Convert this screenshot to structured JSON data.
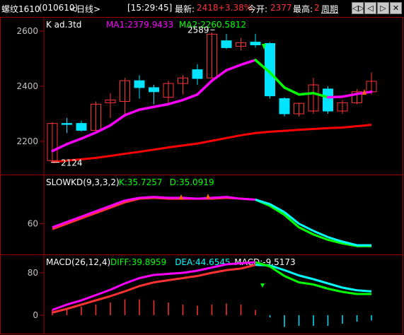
{
  "header": {
    "symbol": "螺纹1610",
    "code": "(010610)",
    "period": "<日线>",
    "time": "[15:29:45]",
    "latest_label": "最新:",
    "latest_value": "2418",
    "change_pct": "+3.38%",
    "open_label": "今开:",
    "open_value": "2377",
    "high_label": "最高:",
    "high_value": "2",
    "week_label": "周期",
    "buttons": [
      "◁▷",
      "◁",
      "▷",
      "✕"
    ]
  },
  "colors": {
    "up": "#ff3232",
    "down": "#00e4ff",
    "ma1": "#ff00ff",
    "ma2": "#ff0000",
    "grid": "#a00000",
    "axis_text": "#c0c0c0",
    "k_line": "#00ffff",
    "d_line": "#ff00ff",
    "green_seg": "#00ff00",
    "white": "#ffffff"
  },
  "chart_data": [
    {
      "type": "candlestick",
      "title": "K  ad.3td",
      "legend": [
        {
          "text": "MA1:2379.9433",
          "color": "#ff00ff"
        },
        {
          "text": "MA2:2260.5812",
          "color": "#00ff00"
        }
      ],
      "yticks": [
        "2600",
        "2400",
        "2200"
      ],
      "ylim": [
        2120,
        2640
      ],
      "annotations": {
        "high": "2589",
        "low": "2124"
      },
      "candles": [
        {
          "o": 2130,
          "h": 2270,
          "l": 2124,
          "c": 2265
        },
        {
          "o": 2265,
          "h": 2285,
          "l": 2230,
          "c": 2262
        },
        {
          "o": 2265,
          "h": 2275,
          "l": 2235,
          "c": 2240
        },
        {
          "o": 2240,
          "h": 2345,
          "l": 2238,
          "c": 2335
        },
        {
          "o": 2340,
          "h": 2375,
          "l": 2285,
          "c": 2350
        },
        {
          "o": 2345,
          "h": 2430,
          "l": 2300,
          "c": 2420
        },
        {
          "o": 2420,
          "h": 2440,
          "l": 2355,
          "c": 2395
        },
        {
          "o": 2395,
          "h": 2405,
          "l": 2335,
          "c": 2380
        },
        {
          "o": 2360,
          "h": 2420,
          "l": 2340,
          "c": 2410
        },
        {
          "o": 2410,
          "h": 2440,
          "l": 2370,
          "c": 2430
        },
        {
          "o": 2460,
          "h": 2480,
          "l": 2405,
          "c": 2428
        },
        {
          "o": 2430,
          "h": 2595,
          "l": 2430,
          "c": 2589
        },
        {
          "o": 2565,
          "h": 2590,
          "l": 2535,
          "c": 2540
        },
        {
          "o": 2545,
          "h": 2575,
          "l": 2530,
          "c": 2558
        },
        {
          "o": 2560,
          "h": 2590,
          "l": 2540,
          "c": 2550
        },
        {
          "o": 2555,
          "h": 2560,
          "l": 2355,
          "c": 2365
        },
        {
          "o": 2355,
          "h": 2360,
          "l": 2290,
          "c": 2300
        },
        {
          "o": 2300,
          "h": 2340,
          "l": 2290,
          "c": 2338
        },
        {
          "o": 2310,
          "h": 2430,
          "l": 2300,
          "c": 2405
        },
        {
          "o": 2390,
          "h": 2400,
          "l": 2300,
          "c": 2310
        },
        {
          "o": 2310,
          "h": 2350,
          "l": 2300,
          "c": 2340
        },
        {
          "o": 2340,
          "h": 2390,
          "l": 2335,
          "c": 2380
        },
        {
          "o": 2380,
          "h": 2450,
          "l": 2370,
          "c": 2418
        }
      ],
      "ma1": [
        2165,
        2190,
        2210,
        2232,
        2258,
        2295,
        2315,
        2325,
        2335,
        2350,
        2370,
        2420,
        2458,
        2478,
        2495,
        2450,
        2395,
        2370,
        2375,
        2360,
        2362,
        2372,
        2380
      ],
      "ma2": [
        2125,
        2130,
        2135,
        2140,
        2147,
        2155,
        2162,
        2170,
        2178,
        2185,
        2192,
        2202,
        2212,
        2222,
        2230,
        2235,
        2238,
        2242,
        2245,
        2248,
        2250,
        2255,
        2260
      ]
    },
    {
      "type": "line",
      "title": "SLOWKD(9,3,3,2)",
      "legend": [
        {
          "text": "K:35.7257",
          "color": "#00ff00"
        },
        {
          "text": "D:35.0919",
          "color": "#00ff00"
        }
      ],
      "yticks": [
        "60"
      ],
      "ylim": [
        32,
        100
      ],
      "k": [
        56,
        62,
        68,
        74,
        80,
        86,
        89,
        90,
        89,
        89,
        88,
        89,
        90,
        88,
        87,
        82,
        73,
        60,
        52,
        45,
        40,
        36,
        36
      ],
      "d": [
        54,
        60,
        66,
        72,
        78,
        84,
        88,
        89,
        88,
        88,
        88,
        88,
        89,
        88,
        87,
        80,
        70,
        56,
        48,
        42,
        38,
        35,
        35
      ]
    },
    {
      "type": "line",
      "title": "MACD(26,12,4)",
      "legend": [
        {
          "text": "DIFF:39.8959",
          "color": "#00ff00"
        },
        {
          "text": "DEA:44.6545",
          "color": "#00ffff"
        },
        {
          "text": "MACD:-9.5173",
          "color": "#ffffff"
        }
      ],
      "yticks": [
        "80",
        "0"
      ],
      "ylim": [
        -20,
        118
      ],
      "diff": [
        10,
        20,
        28,
        38,
        48,
        60,
        70,
        76,
        78,
        80,
        84,
        90,
        96,
        98,
        100,
        92,
        74,
        62,
        58,
        50,
        44,
        40,
        40
      ],
      "dea": [
        5,
        12,
        20,
        28,
        36,
        45,
        55,
        62,
        66,
        70,
        74,
        80,
        85,
        88,
        95,
        94,
        85,
        75,
        68,
        60,
        52,
        47,
        45
      ],
      "macd": [
        10,
        14,
        16,
        20,
        24,
        30,
        30,
        28,
        24,
        20,
        18,
        20,
        22,
        20,
        10,
        -4,
        -22,
        -20,
        -20,
        -20,
        -16,
        -12,
        -10
      ]
    }
  ]
}
